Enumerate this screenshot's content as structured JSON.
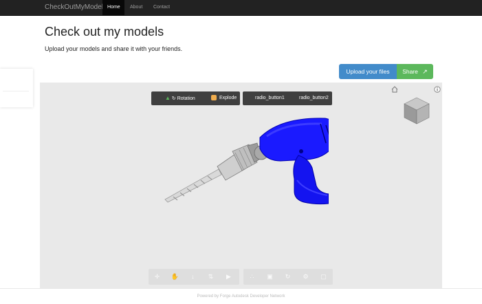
{
  "nav": {
    "brand": "CheckOutMyModel",
    "items": [
      "Home",
      "About",
      "Contact"
    ]
  },
  "header": {
    "title": "Check out my models",
    "subtitle": "Upload your models and share it with your friends."
  },
  "actions": {
    "upload_label": "Upload your files",
    "share_label": "Share"
  },
  "viewer": {
    "toggles": {
      "rotation_label": "Rotation",
      "explode_label": "Explode"
    },
    "radios": {
      "radio1_label": "radio_button1",
      "radio2_label": "radio_button2"
    },
    "toolbar_icons": [
      "move-icon",
      "hand-icon",
      "walk-icon",
      "fit-icon",
      "camera-icon",
      "structure-icon",
      "explode-icon",
      "reset-icon",
      "settings-icon",
      "fullscreen-icon"
    ],
    "model": "cordless-drill"
  },
  "footer": {
    "text": "Powered by Forge Autodesk Developer Network"
  }
}
